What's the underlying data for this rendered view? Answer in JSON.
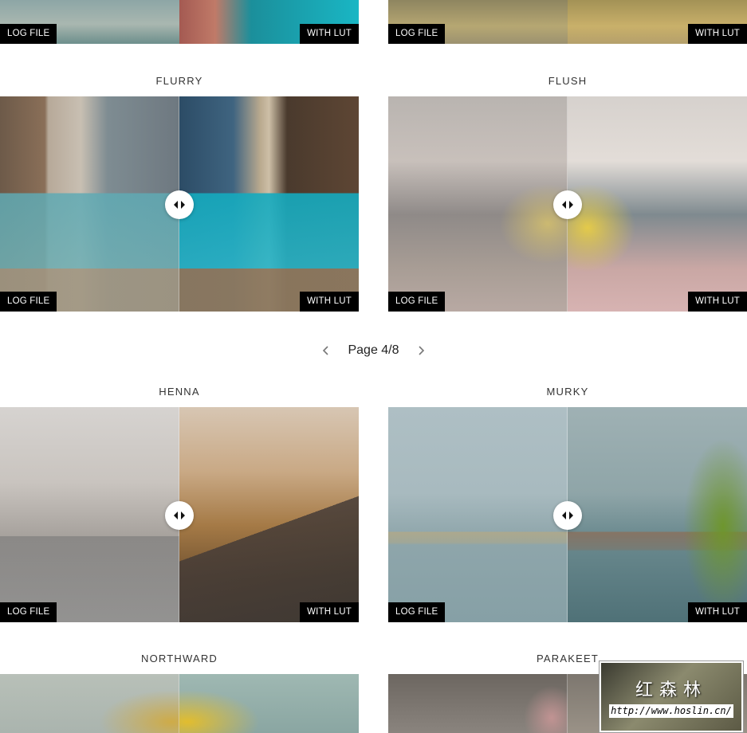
{
  "labels": {
    "log": "LOG FILE",
    "lut": "WITH LUT"
  },
  "pagination": {
    "text": "Page 4/8"
  },
  "cards": [
    {
      "title": "",
      "name": "top-left"
    },
    {
      "title": "",
      "name": "top-right"
    },
    {
      "title": "FLURRY",
      "name": "flurry"
    },
    {
      "title": "FLUSH",
      "name": "flush"
    },
    {
      "title": "HENNA",
      "name": "henna"
    },
    {
      "title": "MURKY",
      "name": "murky"
    },
    {
      "title": "NORTHWARD",
      "name": "northward"
    },
    {
      "title": "PARAKEET",
      "name": "parakeet"
    }
  ],
  "watermark": {
    "chinese": "红森林",
    "url": "http://www.hoslin.cn/"
  },
  "icons": {
    "compare": "compare-arrows-icon",
    "prev": "chevron-left-icon",
    "next": "chevron-right-icon"
  }
}
